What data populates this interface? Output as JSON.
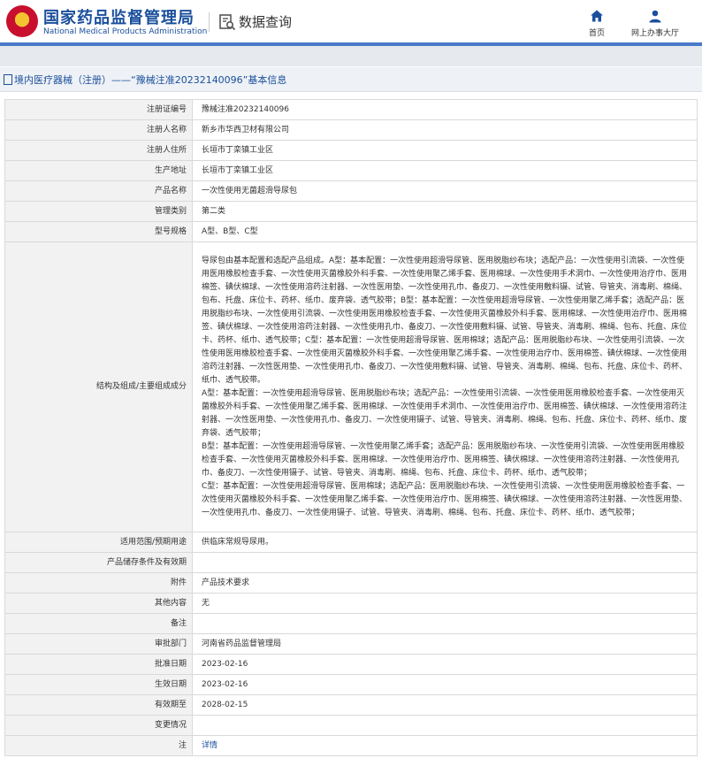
{
  "header": {
    "logo_cn": "国家药品监督管理局",
    "logo_en": "National Medical Products Administration",
    "section_title": "数据查询",
    "nav": [
      {
        "label": "首页",
        "icon": "home-icon"
      },
      {
        "label": "网上办事大厅",
        "icon": "user-icon"
      }
    ],
    "brand_color": "#1a4f9c"
  },
  "page_title": "境内医疗器械（注册）——“豫械注准20232140096”基本信息",
  "rows": [
    {
      "label": "注册证编号",
      "value": "豫械注准20232140096"
    },
    {
      "label": "注册人名称",
      "value": "新乡市华西卫材有限公司"
    },
    {
      "label": "注册人住所",
      "value": "长垣市丁栾镇工业区"
    },
    {
      "label": "生产地址",
      "value": "长垣市丁栾镇工业区"
    },
    {
      "label": "产品名称",
      "value": "一次性使用无菌超滑导尿包"
    },
    {
      "label": "管理类别",
      "value": "第二类"
    },
    {
      "label": "型号规格",
      "value": "A型、B型、C型"
    },
    {
      "label": "结构及组成/主要组成成分",
      "paragraphs": [
        "导尿包由基本配置和选配产品组成。A型：基本配置：一次性使用超滑导尿管、医用脱脂纱布块；选配产品：一次性使用引流袋、一次性使用医用橡胶检查手套、一次性使用灭菌橡胶外科手套、一次性使用聚乙烯手套、医用棉球、一次性使用手术洞巾、一次性使用治疗巾、医用棉签、碘伏棉球、一次性使用溶药注射器、一次性医用垫、一次性使用孔巾、备皮刀、一次性使用敷料镊、试管、导管夹、消毒刷、棉绳、包布、托盘、床位卡、药杯、纸巾、废弃袋、透气胶带；B型：基本配置：一次性使用超滑导尿管、一次性使用聚乙烯手套；选配产品：医用脱脂纱布块、一次性使用引流袋、一次性使用医用橡胶检查手套、一次性使用灭菌橡胶外科手套、医用棉球、一次性使用治疗巾、医用棉签、碘伏棉球、一次性使用溶药注射器、一次性使用孔巾、备皮刀、一次性使用敷料镊、试管、导管夹、消毒刷、棉绳、包布、托盘、床位卡、药杯、纸巾、透气胶带；C型：基本配置：一次性使用超滑导尿管、医用棉球；选配产品：医用脱脂纱布块、一次性使用引流袋、一次性使用医用橡胶检查手套、一次性使用灭菌橡胶外科手套、一次性使用聚乙烯手套、一次性使用治疗巾、医用棉签、碘伏棉球、一次性使用溶药注射器、一次性医用垫、一次性使用孔巾、备皮刀、一次性使用敷料镊、试管、导管夹、消毒刷、棉绳、包布、托盘、床位卡、药杯、纸巾、透气胶带。",
        "A型：基本配置：一次性使用超滑导尿管、医用脱脂纱布块；选配产品：一次性使用引流袋、一次性使用医用橡胶检查手套、一次性使用灭菌橡胶外科手套、一次性使用聚乙烯手套、医用棉球、一次性使用手术洞巾、一次性使用治疗巾、医用棉签、碘伏棉球、一次性使用溶药注射器、一次性医用垫、一次性使用孔巾、备皮刀、一次性使用镊子、试管、导管夹、消毒刷、棉绳、包布、托盘、床位卡、药杯、纸巾、废弃袋、透气胶带；",
        "B型：基本配置：一次性使用超滑导尿管、一次性使用聚乙烯手套；选配产品：医用脱脂纱布块、一次性使用引流袋、一次性使用医用橡胶检查手套、一次性使用灭菌橡胶外科手套、医用棉球、一次性使用治疗巾、医用棉签、碘伏棉球、一次性使用溶药注射器、一次性使用孔巾、备皮刀、一次性使用镊子、试管、导管夹、消毒刷、棉绳、包布、托盘、床位卡、药杯、纸巾、透气胶带；",
        "C型：基本配置：一次性使用超滑导尿管、医用棉球；选配产品：医用脱脂纱布块、一次性使用引流袋、一次性使用医用橡胶检查手套、一次性使用灭菌橡胶外科手套、一次性使用聚乙烯手套、一次性使用治疗巾、医用棉签、碘伏棉球、一次性使用溶药注射器、一次性医用垫、一次性使用孔巾、备皮刀、一次性使用镊子、试管、导管夹、消毒刷、棉绳、包布、托盘、床位卡、药杯、纸巾、透气胶带；"
      ]
    },
    {
      "label": "适用范围/预期用途",
      "value": "供临床常规导尿用。"
    },
    {
      "label": "产品储存条件及有效期",
      "value": ""
    },
    {
      "label": "附件",
      "value": "产品技术要求"
    },
    {
      "label": "其他内容",
      "value": "无"
    },
    {
      "label": "备注",
      "value": ""
    },
    {
      "label": "审批部门",
      "value": "河南省药品监督管理局"
    },
    {
      "label": "批准日期",
      "value": "2023-02-16"
    },
    {
      "label": "生效日期",
      "value": "2023-02-16"
    },
    {
      "label": "有效期至",
      "value": "2028-02-15"
    },
    {
      "label": "变更情况",
      "value": ""
    },
    {
      "label": "注",
      "value": "详情",
      "link": true
    }
  ]
}
